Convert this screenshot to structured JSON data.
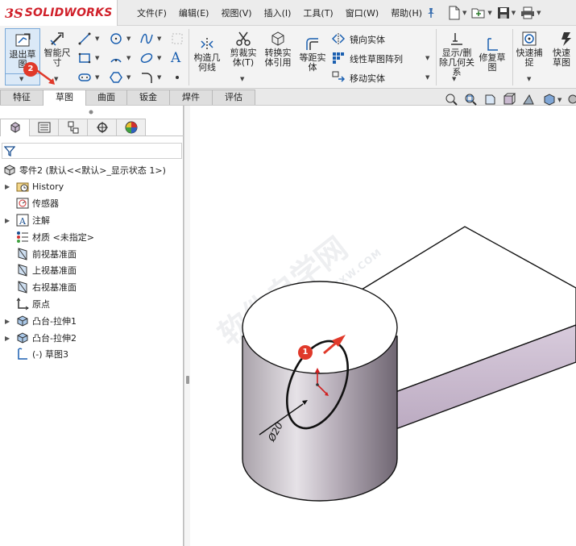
{
  "app": {
    "logo_prefix": "3S",
    "logo_name": "SOLIDWORKS"
  },
  "menu": [
    "文件(F)",
    "编辑(E)",
    "视图(V)",
    "插入(I)",
    "工具(T)",
    "窗口(W)",
    "帮助(H)"
  ],
  "ribbon": {
    "exit_sketch": "退出草图",
    "smart_dimension": "智能尺寸",
    "construction_geometry": "构造几何线",
    "trim_entities": "剪裁实体(T)",
    "convert_entities": "转换实体引用",
    "offset_entities": "等距实体",
    "mirror_entities": "镜向实体",
    "linear_pattern": "线性草图阵列",
    "move_entities": "移动实体",
    "display_delete_relations": "显示/删除几何关系",
    "repair_sketch": "修复草图",
    "quick_snaps": "快速捕捉",
    "rapid_sketch": "快速草图"
  },
  "tabs": [
    {
      "label": "特征",
      "active": false
    },
    {
      "label": "草图",
      "active": true
    },
    {
      "label": "曲面",
      "active": false
    },
    {
      "label": "钣金",
      "active": false
    },
    {
      "label": "焊件",
      "active": false
    },
    {
      "label": "评估",
      "active": false
    }
  ],
  "tree": {
    "root": "零件2 (默认<<默认>_显示状态 1>)",
    "items": [
      {
        "label": "History",
        "icon": "history-folder-icon",
        "expandable": true
      },
      {
        "label": "传感器",
        "icon": "sensor-icon",
        "expandable": false
      },
      {
        "label": "注解",
        "icon": "annotation-icon",
        "expandable": true
      },
      {
        "label": "材质 <未指定>",
        "icon": "material-icon",
        "expandable": false
      },
      {
        "label": "前视基准面",
        "icon": "plane-icon",
        "expandable": false
      },
      {
        "label": "上视基准面",
        "icon": "plane-icon",
        "expandable": false
      },
      {
        "label": "右视基准面",
        "icon": "plane-icon",
        "expandable": false
      },
      {
        "label": "原点",
        "icon": "origin-icon",
        "expandable": false
      },
      {
        "label": "凸台-拉伸1",
        "icon": "boss-extrude-icon",
        "expandable": true
      },
      {
        "label": "凸台-拉伸2",
        "icon": "boss-extrude-icon",
        "expandable": true
      },
      {
        "label": "(-) 草图3",
        "icon": "sketch-icon",
        "expandable": false
      }
    ]
  },
  "viewport": {
    "dimension": "Ø20",
    "badge_1": "1",
    "badge_2": "2",
    "watermark": "软件自学网",
    "watermark_url": "WWW.RJZXW.COM"
  },
  "colors": {
    "accent_red": "#d0202a",
    "badge_red": "#e0392a",
    "model_lilac": "#c9b9cf"
  }
}
